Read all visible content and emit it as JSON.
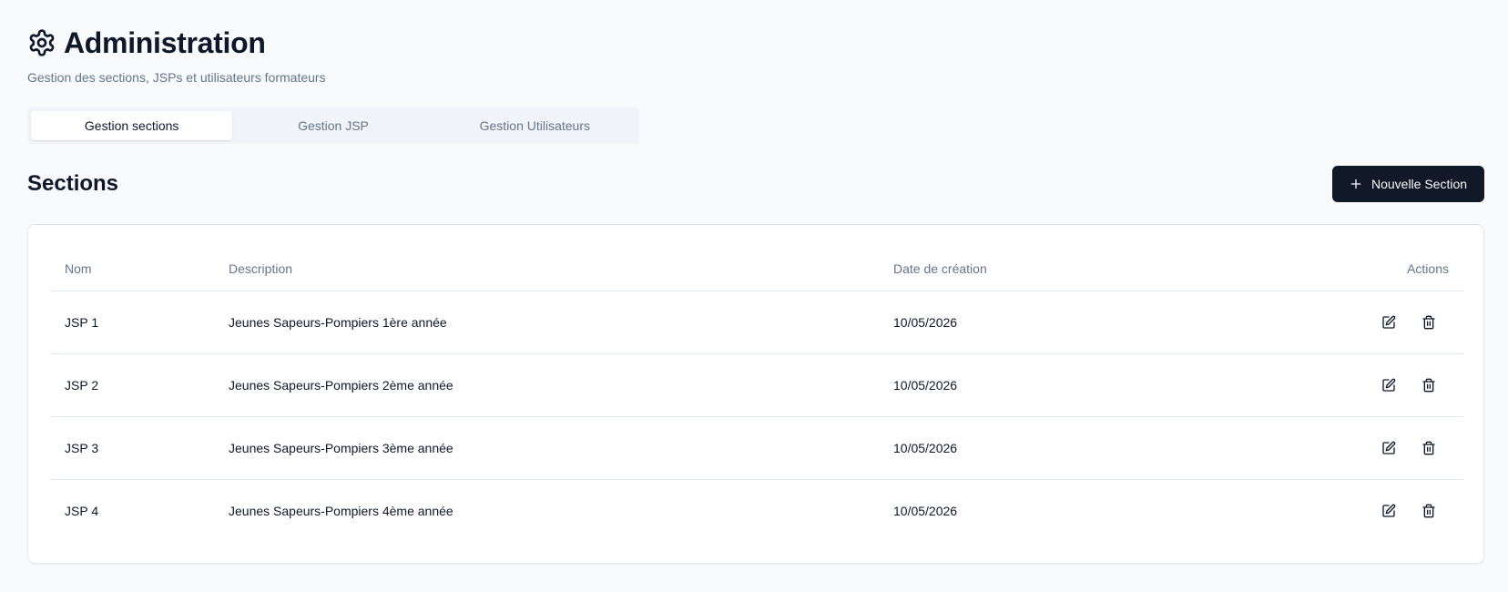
{
  "header": {
    "icon": "gear-icon",
    "title": "Administration",
    "subtitle": "Gestion des sections, JSPs et utilisateurs formateurs"
  },
  "tabs": [
    {
      "label": "Gestion sections",
      "active": true
    },
    {
      "label": "Gestion JSP",
      "active": false
    },
    {
      "label": "Gestion Utilisateurs",
      "active": false
    }
  ],
  "sections": {
    "title": "Sections",
    "new_button": {
      "icon": "plus-icon",
      "label": "Nouvelle Section"
    },
    "table": {
      "columns": [
        "Nom",
        "Description",
        "Date de création",
        "Actions"
      ],
      "rows": [
        {
          "name": "JSP 1",
          "description": "Jeunes Sapeurs-Pompiers 1ère année",
          "date": "10/05/2026"
        },
        {
          "name": "JSP 2",
          "description": "Jeunes Sapeurs-Pompiers 2ème année",
          "date": "10/05/2026"
        },
        {
          "name": "JSP 3",
          "description": "Jeunes Sapeurs-Pompiers 3ème année",
          "date": "10/05/2026"
        },
        {
          "name": "JSP 4",
          "description": "Jeunes Sapeurs-Pompiers 4ème année",
          "date": "10/05/2026"
        }
      ],
      "row_actions": [
        "edit-icon",
        "trash-icon"
      ]
    }
  },
  "colors": {
    "background": "#f8fafc",
    "primary_button": "#111827",
    "muted_text": "#64748b",
    "border": "#e2e8f0"
  }
}
